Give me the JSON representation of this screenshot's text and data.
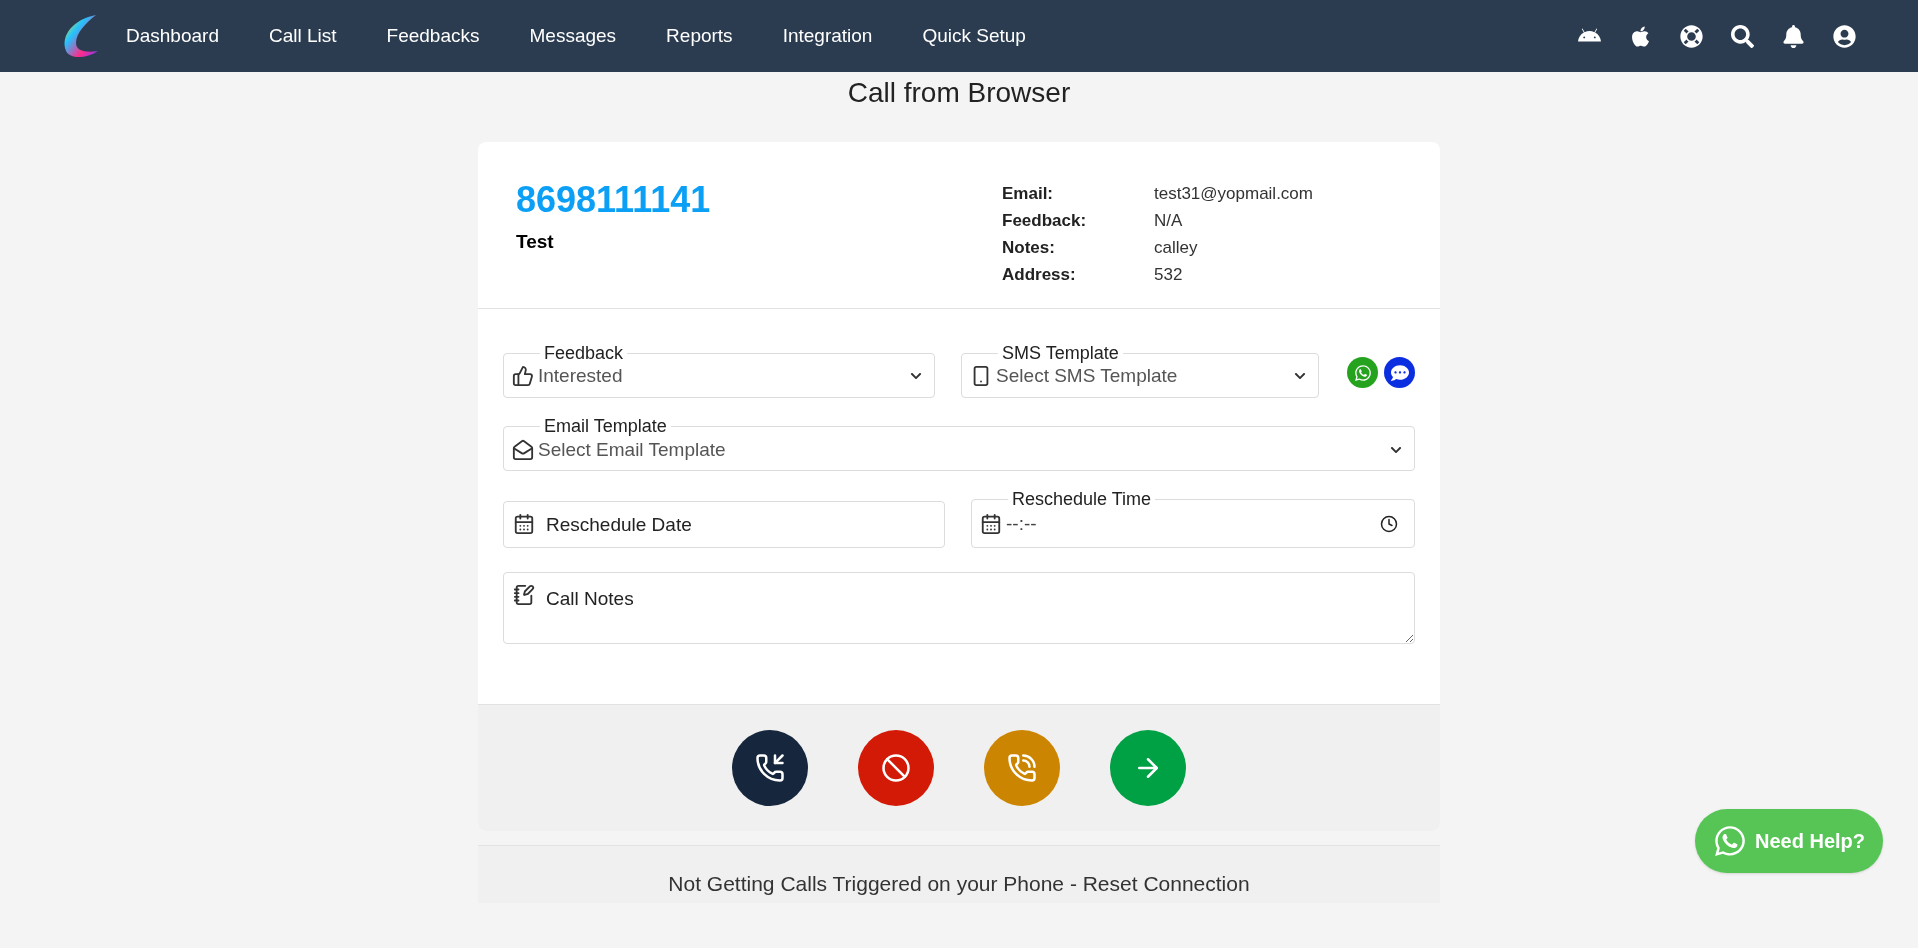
{
  "nav": {
    "items": [
      {
        "label": "Dashboard"
      },
      {
        "label": "Call List"
      },
      {
        "label": "Feedbacks"
      },
      {
        "label": "Messages"
      },
      {
        "label": "Reports"
      },
      {
        "label": "Integration"
      },
      {
        "label": "Quick Setup"
      }
    ],
    "icons": [
      {
        "kind": "android"
      },
      {
        "kind": "apple"
      },
      {
        "kind": "help"
      },
      {
        "kind": "search"
      },
      {
        "kind": "bell"
      },
      {
        "kind": "user"
      }
    ]
  },
  "page_title": "Call from Browser",
  "contact": {
    "number": "8698111141",
    "name": "Test",
    "details": [
      {
        "label": "Email:",
        "value": "test31@yopmail.com"
      },
      {
        "label": "Feedback:",
        "value": "N/A"
      },
      {
        "label": "Notes:",
        "value": "calley"
      },
      {
        "label": "Address:",
        "value": "532"
      }
    ]
  },
  "form": {
    "feedback": {
      "label": "Feedback",
      "value": "Interested"
    },
    "sms_template": {
      "label": "SMS Template",
      "value": "Select SMS Template"
    },
    "sms_buttons": [
      {
        "kind": "whatsapp",
        "color": "#25a31f"
      },
      {
        "kind": "sms",
        "color": "#0a2ee0"
      }
    ],
    "email_template": {
      "label": "Email Template",
      "value": "Select Email Template"
    },
    "reschedule_date": {
      "placeholder": "Reschedule Date"
    },
    "reschedule_time": {
      "label": "Reschedule Time",
      "value": "--:--"
    },
    "call_notes": {
      "placeholder": "Call Notes"
    }
  },
  "actions": [
    {
      "kind": "incoming",
      "color": "#15263d"
    },
    {
      "kind": "block",
      "color": "#d31a06"
    },
    {
      "kind": "hold",
      "color": "#cc8500"
    },
    {
      "kind": "next",
      "color": "#00a044"
    }
  ],
  "footer_text": "Not Getting Calls Triggered on your Phone - Reset Connection",
  "help_button": "Need Help?"
}
